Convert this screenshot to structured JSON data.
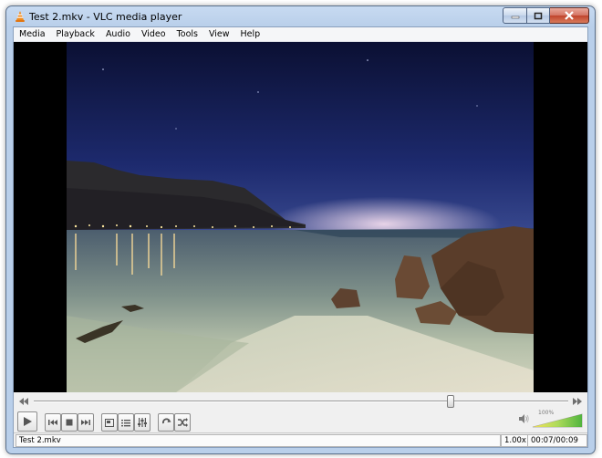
{
  "window": {
    "title": "Test 2.mkv - VLC media player",
    "app_icon": "vlc-cone-icon",
    "caption_buttons": [
      "minimize-icon",
      "maximize-icon",
      "close-icon"
    ]
  },
  "menubar": {
    "items": [
      "Media",
      "Playback",
      "Audio",
      "Video",
      "Tools",
      "View",
      "Help"
    ]
  },
  "player": {
    "video_description_hidden": true,
    "seek_position_fraction": 0.78,
    "volume_level": "100%",
    "volume_fraction": 1.0
  },
  "controls": {
    "icons": [
      "play-icon",
      "previous-icon",
      "stop-icon",
      "next-icon",
      "fullscreen-icon",
      "playlist-icon",
      "extended-settings-icon",
      "loop-icon",
      "shuffle-icon"
    ]
  },
  "status": {
    "filename": "Test 2.mkv",
    "speed": "1.00x",
    "time": "00:07/00:09"
  },
  "colors": {
    "accent_volume_low": "#f7e24a",
    "accent_volume_mid": "#a6d84a",
    "accent_volume_high": "#3fae2a"
  }
}
